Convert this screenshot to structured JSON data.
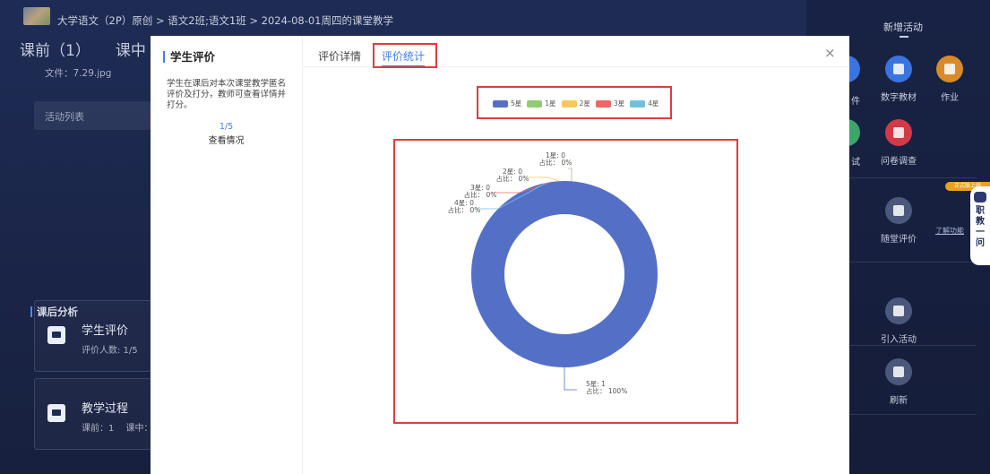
{
  "header": {
    "breadcrumb": "大学语文（2P）原创 > 语文2班;语文1班 > 2024-08-01周四的课堂教学"
  },
  "phases": {
    "before": "课前（1）",
    "during": "课中（"
  },
  "file_line": "文件：7.29.jpg",
  "activity_list": "活动列表",
  "after_class": {
    "title": "课后分析",
    "cards": [
      {
        "title": "学生评价",
        "sub": "评价人数: 1/5"
      },
      {
        "title": "教学过程",
        "sub": "课前：1　 课中："
      }
    ]
  },
  "right_panel": {
    "new_activity": "新增活动",
    "tool_partial_top": "件",
    "tool_partial_mid": "试",
    "tools": [
      {
        "label": "数字教材",
        "color": "#3a74e0"
      },
      {
        "label": "作业",
        "color": "#d98a2b"
      },
      {
        "label": "问卷调查",
        "color": "#d13a46"
      },
      {
        "label": "随堂评价",
        "color": "#4b587c"
      },
      {
        "label": "引入活动",
        "color": "#4b587c"
      },
      {
        "label": "刷新",
        "color": "#4b587c"
      }
    ],
    "learn_more": "了解功能",
    "ai_tag": "正式版上线",
    "ai_text": "职教一问"
  },
  "modal": {
    "left_title": "学生评价",
    "left_desc": "学生在课后对本次课堂教学匿名评价及打分，教师可查看详情并打分。",
    "left_count": "1/5",
    "left_link": "查看情况",
    "tabs": [
      "评价详情",
      "评价统计"
    ],
    "active_tab": "评价统计",
    "close_icon": "×"
  },
  "chart_data": {
    "type": "pie",
    "style": "donut",
    "legend": [
      "5星",
      "1星",
      "2星",
      "3星",
      "4星"
    ],
    "legend_position": "top",
    "series": [
      {
        "name": "5星",
        "value": 1,
        "percent": "100%",
        "color": "#5470c6"
      },
      {
        "name": "1星",
        "value": 0,
        "percent": "0%",
        "color": "#91cc75"
      },
      {
        "name": "2星",
        "value": 0,
        "percent": "0%",
        "color": "#fac858"
      },
      {
        "name": "3星",
        "value": 0,
        "percent": "0%",
        "color": "#ee6666"
      },
      {
        "name": "4星",
        "value": 0,
        "percent": "0%",
        "color": "#73c0de"
      }
    ],
    "percent_prefix": "占比："
  }
}
